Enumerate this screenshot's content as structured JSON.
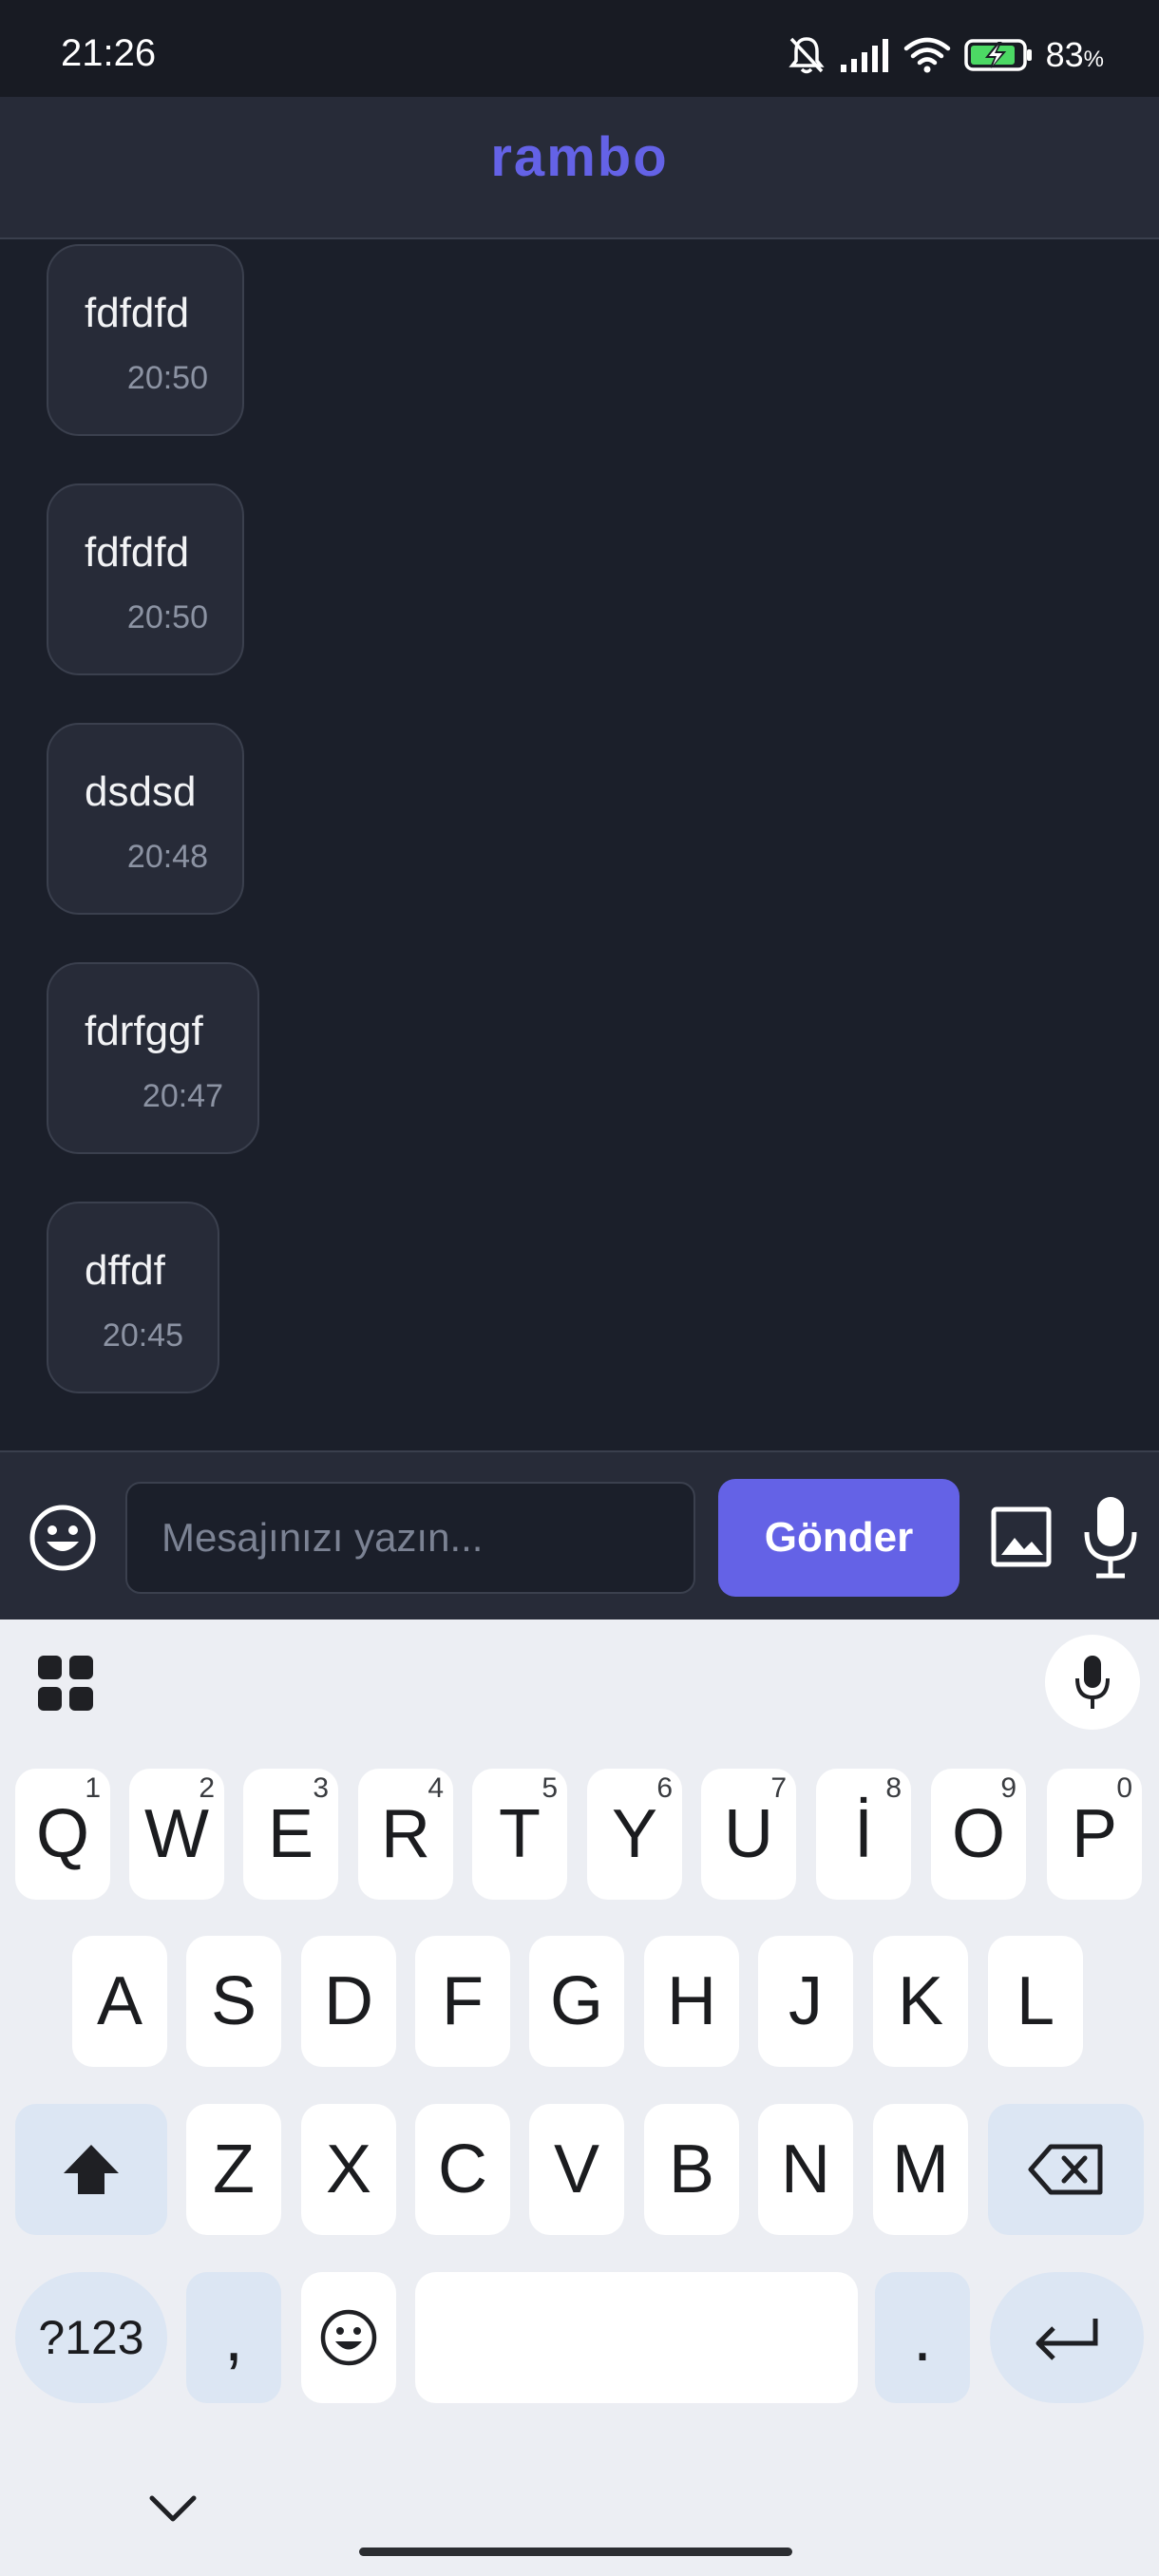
{
  "status_bar": {
    "time": "21:26",
    "battery_percent": "83",
    "battery_unit": "%",
    "icons": [
      "bell-off-icon",
      "signal-icon",
      "wifi-icon",
      "battery-charging-icon"
    ]
  },
  "header": {
    "title": "rambo"
  },
  "messages": [
    {
      "text": "fdfdfd",
      "time": "20:50"
    },
    {
      "text": "fdfdfd",
      "time": "20:50"
    },
    {
      "text": "dsdsd",
      "time": "20:48"
    },
    {
      "text": "fdrfggf",
      "time": "20:47"
    },
    {
      "text": "dffdf",
      "time": "20:45"
    }
  ],
  "composer": {
    "placeholder": "Mesajınızı yazın...",
    "value": "",
    "send_label": "Gönder",
    "icons": [
      "emoji-icon",
      "image-icon",
      "microphone-icon"
    ]
  },
  "keyboard": {
    "row1": [
      {
        "key": "Q",
        "hint": "1"
      },
      {
        "key": "W",
        "hint": "2"
      },
      {
        "key": "E",
        "hint": "3"
      },
      {
        "key": "R",
        "hint": "4"
      },
      {
        "key": "T",
        "hint": "5"
      },
      {
        "key": "Y",
        "hint": "6"
      },
      {
        "key": "U",
        "hint": "7"
      },
      {
        "key": "İ",
        "hint": "8"
      },
      {
        "key": "O",
        "hint": "9"
      },
      {
        "key": "P",
        "hint": "0"
      }
    ],
    "row2": [
      "A",
      "S",
      "D",
      "F",
      "G",
      "H",
      "J",
      "K",
      "L"
    ],
    "row3": [
      "Z",
      "X",
      "C",
      "V",
      "B",
      "N",
      "M"
    ],
    "symbols_label": "?123",
    "comma_label": ",",
    "period_label": ".",
    "space_label": "",
    "icons": [
      "apps-grid-icon",
      "keyboard-mic-icon",
      "shift-icon",
      "backspace-icon",
      "emoji-icon",
      "enter-icon",
      "chevron-down-icon"
    ]
  },
  "colors": {
    "accent": "#6462e6",
    "background": "#1b1f2a",
    "surface": "#272b38",
    "bubble_border": "#3b404e",
    "muted_text": "#8c93a3",
    "keyboard_bg": "#eceef3",
    "modifier_key": "#dce6f3"
  }
}
